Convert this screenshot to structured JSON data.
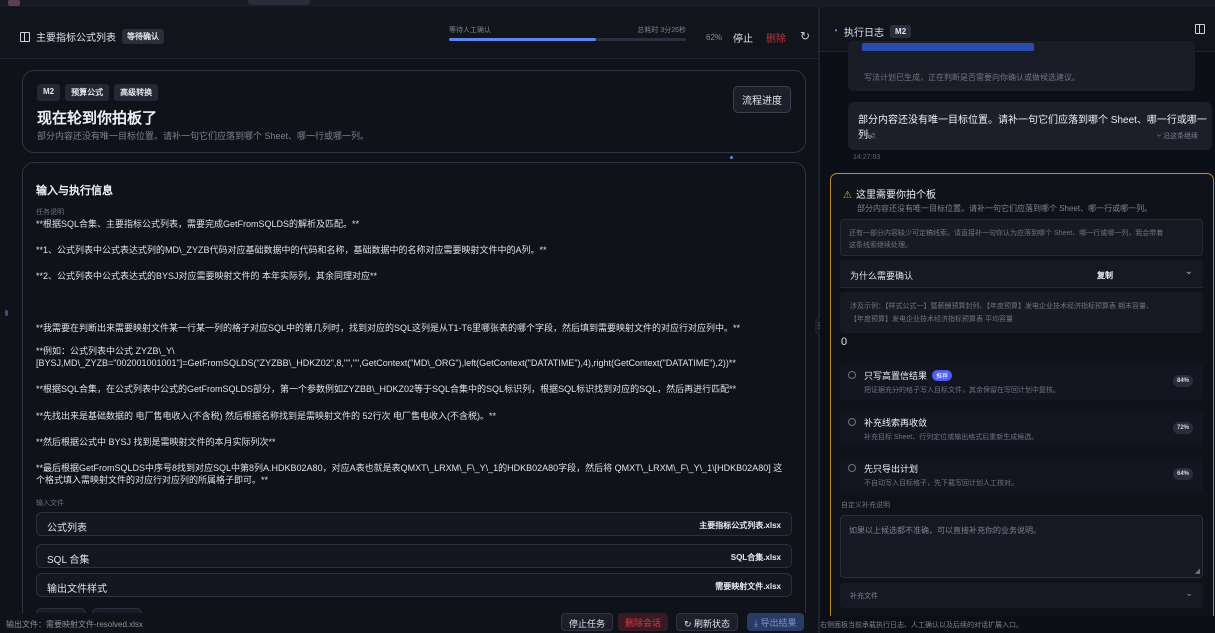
{
  "left_header": {
    "title": "主要指标公式列表",
    "status_badge": "等待确认"
  },
  "progress": {
    "label": "等待人工确认",
    "elapsed": "总耗时 3分26秒",
    "percent_text": "62%",
    "value": 0.62,
    "stop_label": "停止",
    "delete_label": "删除",
    "accent": "#5b86ee"
  },
  "prompt_card": {
    "tags": [
      "M2",
      "预算公式",
      "高级转换"
    ],
    "title": "现在轮到你拍板了",
    "subtitle": "部分内容还没有唯一目标位置。请补一句它们应落到哪个 Sheet、哪一行或哪一列。",
    "flow_button": "流程进度"
  },
  "info_card": {
    "heading": "输入与执行信息",
    "task_caption": "任务说明",
    "paragraphs": [
      "**根据SQL合集、主要指标公式列表，需要完成GetFromSQLDS的解析及匹配。**",
      "**1、公式列表中公式表达式列的MD\\_ZYZB代码对应基础数据中的代码和名称，基础数据中的名称对应需要映射文件中的A列。**",
      "**2、公式列表中公式表达式的BYSJ对应需要映射文件的 本年实际列，其余同理对应**",
      "**我需要在判断出来需要映射文件某一行某一列的格子对应SQL中的第几列时，找到对应的SQL这列是从T1-T6里哪张表的哪个字段，然后填到需要映射文件的对应行对应列中。**",
      "**例如：公式列表中公式 ZYZB\\_Y\\",
      "[BYSJ,MD\\_ZYZB=\"002001001001\"]=GetFromSQLDS(\"ZYZBB\\_HDKZ02\",8,\"\",\"\",GetContext(\"MD\\_ORG\"),left(GetContext(\"DATATIME\"),4),right(GetContext(\"DATATIME\"),2))**",
      "**根据SQL合集，在公式列表中公式的GetFromSQLDS部分，第一个参数例如ZYZBB\\_HDKZ02等于SQL合集中的SQL标识列，根据SQL标识找到对应的SQL，然后再进行匹配**",
      "**先找出来是基础数据的 电厂售电收入(不含税) 然后根据名称找到是需映射文件的 52行次 电厂售电收入(不含税)。**",
      "**然后根据公式中 BYSJ 找到是需映射文件的本月实际列次**",
      "**最后根据GetFromSQLDS中序号8找到对应SQL中第8列A.HDKB02A80，对应A表也就是表QMXT\\_LRXM\\_F\\_Y\\_1的HDKB02A80字段，然后将 QMXT\\_LRXM\\_F\\_Y\\_1\\[HDKB02A80] 这",
      "个格式填入需映射文件的对应行对应列的所属格子即可。**"
    ],
    "files_caption": "输入文件",
    "files": [
      {
        "label": "公式列表",
        "file": "主要指标公式列表.xlsx"
      },
      {
        "label": "SQL 合集",
        "file": "SQL合集.xlsx"
      },
      {
        "label": "输出文件样式",
        "file": "需要映射文件.xlsx"
      }
    ]
  },
  "left_footer": {
    "output": "输出文件：需要映射文件-resolved.xlsx",
    "stop_task": "停止任务",
    "delete_session": "删除会话",
    "refresh": "刷新状态",
    "export": "导出结果"
  },
  "right_header": {
    "title": "执行日志",
    "badge": "M2"
  },
  "log": {
    "item1_text": "写法计划已生成，正在判断是否需要向你确认或做候选建议。",
    "item2_title": "部分内容还没有唯一目标位置。请补一句它们应落到哪个 Sheet、哪一行或哪一列。",
    "item2_source": "主节点",
    "item2_action": "沿这条继续",
    "time": "14:27:03"
  },
  "decision": {
    "title": "这里需要你拍个板",
    "subtitle": "部分内容还没有唯一目标位置。请补一句它们应落到哪个 Sheet、哪一行或哪一列。",
    "info_line1": "还有一部分内容缺少可定稿线索。请直接补一句你认为应落到哪个 Sheet、哪一行或哪一列，我会带着",
    "info_line2": "这条线索继续处理。",
    "why_label": "为什么需要确认",
    "copy_label": "复制",
    "example_line1": "涉及示例：【样式公式一】暨薪酬预算封列、【年度预算】发电企业技术经济指标预算表 期末容量、",
    "example_line2": "【年度预算】发电企业技术经济指标预算表 平均容量",
    "count": "0",
    "options": [
      {
        "title": "只写高置信结果",
        "tag": "推荐",
        "desc": "把证据充分的格子写入目标文件，其余保留在写回计划中复核。",
        "score": "84%"
      },
      {
        "title": "补充线索再收敛",
        "tag": "",
        "desc": "补充目标 Sheet、行列定位或输出格式后重新生成候选。",
        "score": "72%"
      },
      {
        "title": "先只导出计划",
        "tag": "",
        "desc": "不自动写入目标格子，先下载写回计划人工核对。",
        "score": "64%"
      }
    ],
    "custom_label": "自定义补充说明",
    "custom_placeholder": "如果以上候选都不准确，可以直接补充你的业务说明。",
    "supplement_label": "补充文件"
  },
  "right_footer": "右侧面板当前承载执行日志、人工确认以及后续的对话扩展入口。",
  "colors": {
    "accent": "#5b86ee",
    "danger": "#c22f3b",
    "warning_border": "#c4862c"
  }
}
